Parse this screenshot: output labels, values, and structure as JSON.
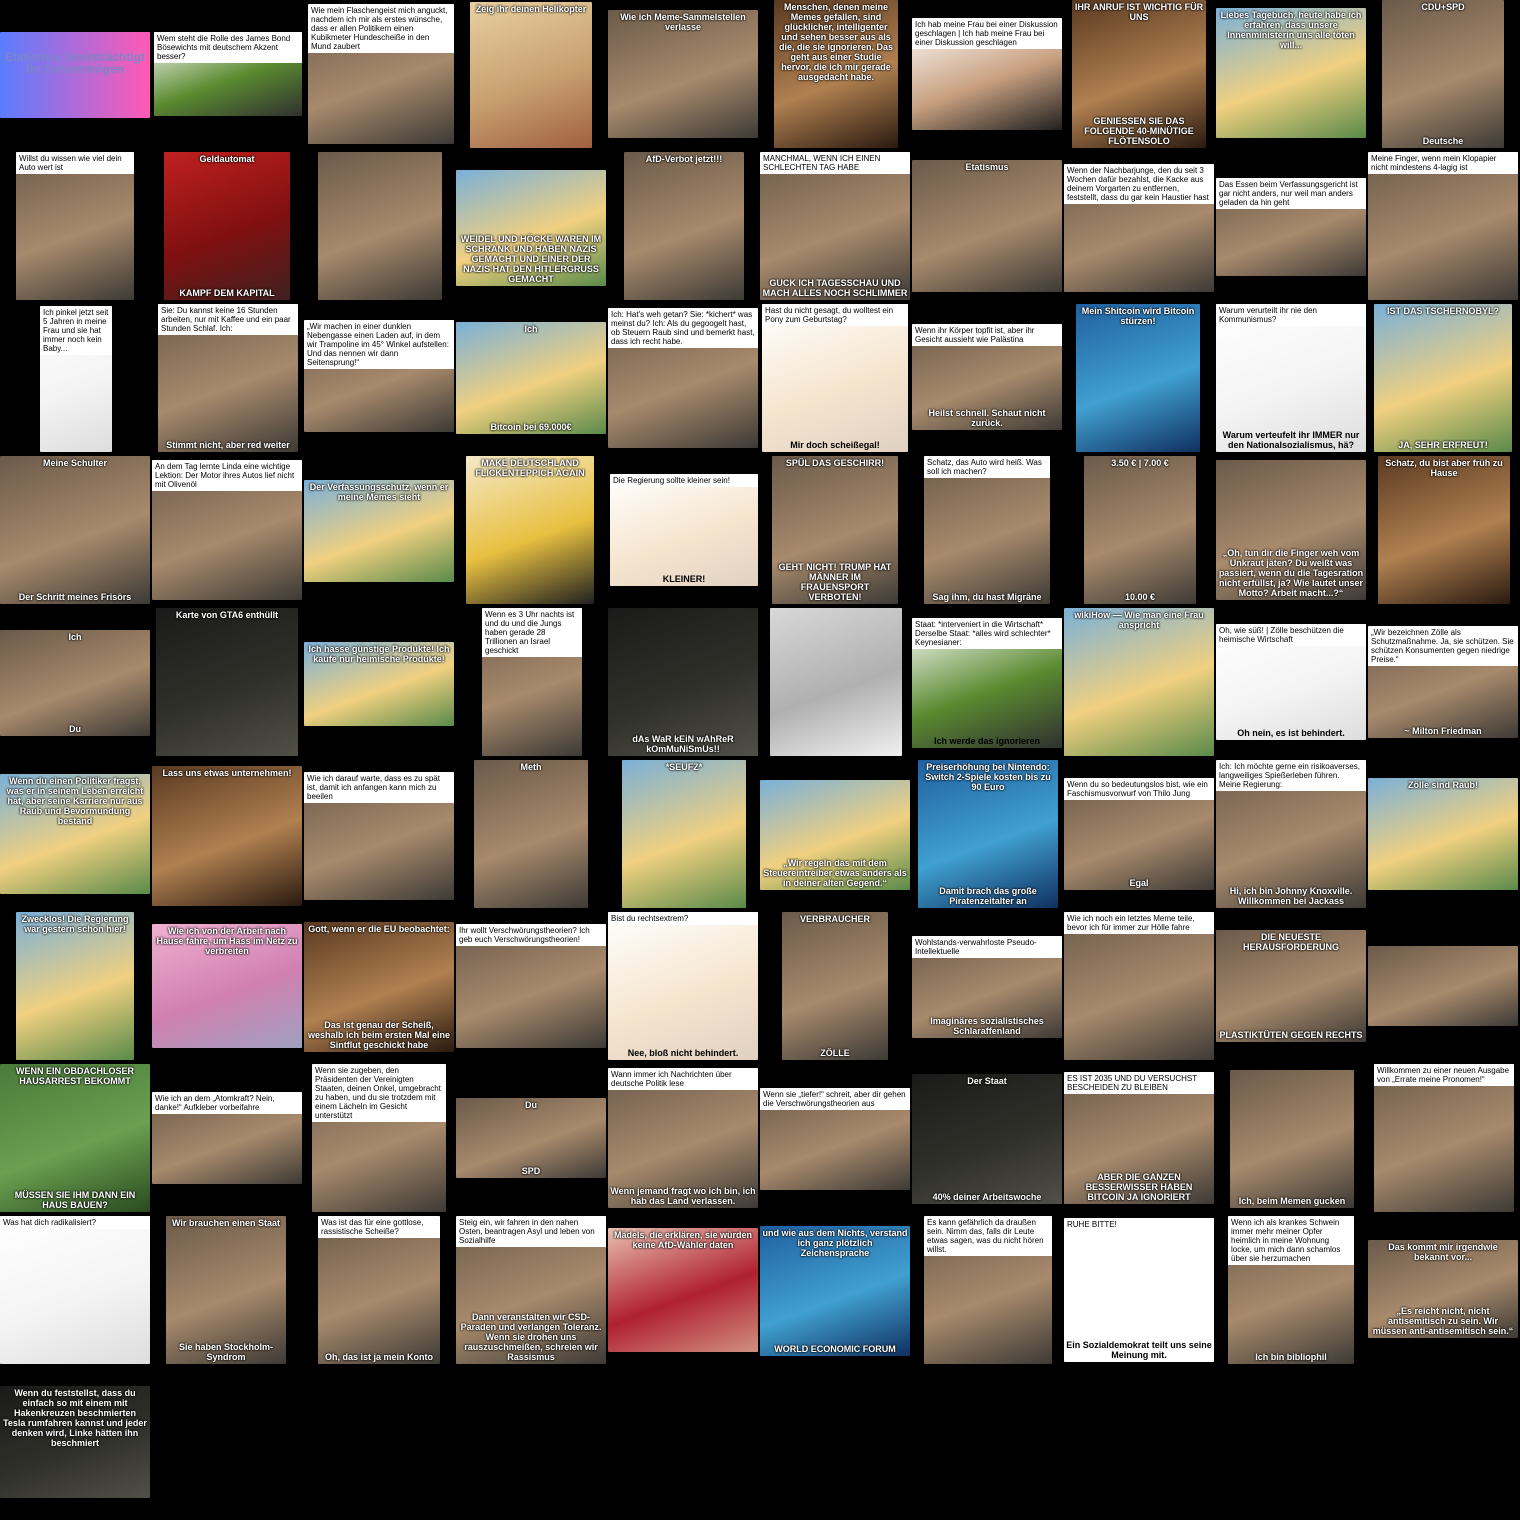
{
  "gallery": {
    "rows": [
      [
        {
          "top": "Etatismus beeinträchtigt Ihr Sehvermögen",
          "bottom": ""
        },
        {
          "top": "Wem steht die Rolle des James Bond Bösewichts mit deutschem Akzent besser?",
          "bottom": ""
        },
        {
          "top": "Wie mein Flaschengeist mich anguckt, nachdem ich mir als erstes wünsche, dass er allen Politikern einen Kubikmeter Hundescheiße in den Mund zaubert",
          "bottom": ""
        },
        {
          "top": "Zeig ihr deinen Helikopter",
          "bottom": ""
        },
        {
          "top": "Wie ich Meme-Sammelstellen verlasse",
          "bottom": ""
        },
        {
          "top": "Menschen, denen meine Memes gefallen, sind glücklicher, intelligenter und sehen besser aus als die, die sie ignorieren. Das geht aus einer Studie hervor, die ich mir gerade ausgedacht habe.",
          "bottom": ""
        },
        {
          "top": "Ich hab meine Frau bei einer Diskussion geschlagen | Ich hab meine Frau bei einer Diskussion geschlagen",
          "bottom": ""
        },
        {
          "top": "IHR ANRUF IST WICHTIG FÜR UNS",
          "bottom": "GENIESSEN SIE DAS FOLGENDE 40-MINÜTIGE FLÖTENSOLO"
        },
        {
          "top": "Liebes Tagebuch, heute habe ich erfahren, dass unsere Innenministerin uns alle töten will...",
          "bottom": ""
        },
        {
          "top": "CDU+SPD",
          "bottom": "Deutsche"
        }
      ],
      [
        {
          "top": "Willst du wissen wie viel dein Auto wert ist",
          "bottom": ""
        },
        {
          "top": "Geldautomat",
          "bottom": "KAMPF DEM KAPITAL"
        },
        {
          "top": "",
          "bottom": ""
        },
        {
          "top": "",
          "bottom": "WEIDEL UND HÖCKE WAREN IM SCHRANK UND HABEN NAZIS GEMACHT UND EINER DER NAZIS HAT DEN HITLERGRUSS GEMACHT"
        },
        {
          "top": "AfD-Verbot jetzt!!!",
          "bottom": ""
        },
        {
          "top": "MANCHMAL, WENN ICH EINEN SCHLECHTEN TAG HABE",
          "bottom": "GUCK ICH TAGESSCHAU UND MACH ALLES NOCH SCHLIMMER"
        },
        {
          "top": "Etatismus",
          "bottom": ""
        },
        {
          "top": "Wenn der Nachbarjunge, den du seit 3 Wochen dafür bezahlst, die Kacke aus deinem Vorgarten zu entfernen, feststellt, dass du gar kein Haustier hast",
          "bottom": ""
        },
        {
          "top": "Das Essen beim Verfassungsgericht ist gar nicht anders, nur weil man anders geladen da hin geht",
          "bottom": ""
        },
        {
          "top": "Meine Finger, wenn mein Klopapier nicht mindestens 4-lagig ist",
          "bottom": ""
        }
      ],
      [
        {
          "top": "Ich pinkel jetzt seit 5 Jahren in meine Frau und sie hat immer noch kein Baby...",
          "bottom": ""
        },
        {
          "top": "Sie: Du kannst keine 16 Stunden arbeiten, nur mit Kaffee und ein paar Stunden Schlaf. Ich:",
          "bottom": "Stimmt nicht, aber red weiter"
        },
        {
          "top": "„Wir machen in einer dunklen Nebengasse einen Laden auf, in dem wir Trampoline im 45° Winkel aufstellen: Und das nennen wir dann Seitensprung!“",
          "bottom": ""
        },
        {
          "top": "Ich",
          "bottom": "Bitcoin bei 69.000€"
        },
        {
          "top": "Ich: Hat's weh getan? Sie: *kichert* was meinst du? Ich: Als du gegoogelt hast, ob Steuern Raub sind und bemerkt hast, dass ich recht habe.",
          "bottom": ""
        },
        {
          "top": "Hast du nicht gesagt, du wolltest ein Pony zum Geburtstag?",
          "bottom": "Mir doch scheißegal!"
        },
        {
          "top": "Wenn ihr Körper topfit ist, aber ihr Gesicht aussieht wie Palästina",
          "bottom": "Heilst schnell. Schaut nicht zurück."
        },
        {
          "top": "Mein Shitcoin wird Bitcoin stürzen!",
          "bottom": ""
        },
        {
          "top": "Warum verurteilt ihr nie den Kommunismus?",
          "bottom": "Warum verteufelt ihr IMMER nur den Nationalsozialismus, hä?"
        },
        {
          "top": "IST DAS TSCHERNOBYL?",
          "bottom": "JA, SEHR ERFREUT!"
        }
      ],
      [
        {
          "top": "Meine Schulter",
          "bottom": "Der Schritt meines Frisörs"
        },
        {
          "top": "An dem Tag lernte Linda eine wichtige Lektion: Der Motor ihres Autos lief nicht mit Olivenöl",
          "bottom": ""
        },
        {
          "top": "Der Verfassungsschutz, wenn er meine Memes sieht",
          "bottom": ""
        },
        {
          "top": "MAKE DEUTSCHLAND FLICKENTEPPICH AGAIN",
          "bottom": ""
        },
        {
          "top": "Die Regierung sollte kleiner sein!",
          "bottom": "KLEINER!"
        },
        {
          "top": "SPÜL DAS GESCHIRR!",
          "bottom": "GEHT NICHT! TRUMP HAT MÄNNER IM FRAUENSPORT VERBOTEN!"
        },
        {
          "top": "Schatz, das Auto wird heiß. Was soll ich machen?",
          "bottom": "Sag ihm, du hast Migräne"
        },
        {
          "top": "3.50 € | 7.00 €",
          "bottom": "10.00 €"
        },
        {
          "top": "",
          "bottom": "„Oh, tun dir die Finger weh vom Unkraut jäten? Du weißt was passiert, wenn du die Tagesration nicht erfüllst, ja? Wie lautet unser Motto? Arbeit macht...?“"
        },
        {
          "top": "Schatz, du bist aber früh zu Hause",
          "bottom": ""
        }
      ],
      [
        {
          "top": "Ich",
          "bottom": "Du"
        },
        {
          "top": "Karte von GTA6 enthüllt",
          "bottom": ""
        },
        {
          "top": "Ich hasse günstige Produkte! Ich kaufe nur heimische Produkte!",
          "bottom": ""
        },
        {
          "top": "Wenn es 3 Uhr nachts ist und du und die Jungs haben gerade 28 Trillionen an Israel geschickt",
          "bottom": ""
        },
        {
          "top": "",
          "bottom": "dAs WaR kEiN wAhReR kOmMuNiSmUs!!"
        },
        {
          "top": "",
          "bottom": ""
        },
        {
          "top": "Staat: *interveniert in die Wirtschaft* Derselbe Staat: *alles wird schlechter* Keynesianer:",
          "bottom": "Ich werde das ignorieren"
        },
        {
          "top": "wikiHow — Wie man eine Frau anspricht",
          "bottom": ""
        },
        {
          "top": "Oh, wie süß! | Zölle beschützen die heimische Wirtschaft",
          "bottom": "Oh nein, es ist behindert."
        },
        {
          "top": "„Wir bezeichnen Zölle als Schutzmaßnahme. Ja, sie schützen. Sie schützen Konsumenten gegen niedrige Preise.“",
          "bottom": "~ Milton Friedman"
        }
      ],
      [
        {
          "top": "Wenn du einen Politiker fragst, was er in seinem Leben erreicht hat, aber seine Karriere nur aus Raub und Bevormundung bestand",
          "bottom": ""
        },
        {
          "top": "Lass uns etwas unternehmen!",
          "bottom": ""
        },
        {
          "top": "Wie ich darauf warte, dass es zu spät ist, damit ich anfangen kann mich zu beeilen",
          "bottom": ""
        },
        {
          "top": "Meth",
          "bottom": ""
        },
        {
          "top": "*SEUFZ*",
          "bottom": ""
        },
        {
          "top": "",
          "bottom": "„Wir regeln das mit dem Steuereintreiber etwas anders als in deiner alten Gegend.“"
        },
        {
          "top": "Preiserhöhung bei Nintendo: Switch 2-Spiele kosten bis zu 90 Euro",
          "bottom": "Damit brach das große Piratenzeitalter an"
        },
        {
          "top": "Wenn du so bedeutungslos bist, wie ein Faschismusvorwurf von Thilo Jung",
          "bottom": "Egal"
        },
        {
          "top": "Ich: Ich möchte gerne ein risikoaverses, langweiliges Spießerleben führen. Meine Regierung:",
          "bottom": "Hi, ich bin Johnny Knoxville. Willkommen bei Jackass"
        },
        {
          "top": "Zölle sind Raub!",
          "bottom": ""
        }
      ],
      [
        {
          "top": "Zwecklos! Die Regierung war gestern schon hier!",
          "bottom": ""
        },
        {
          "top": "Wie ich von der Arbeit nach Hause fahre, um Hass im Netz zu verbreiten",
          "bottom": ""
        },
        {
          "top": "Gott, wenn er die EU beobachtet:",
          "bottom": "Das ist genau der Scheiß, weshalb ich beim ersten Mal eine Sintflut geschickt habe"
        },
        {
          "top": "Ihr wollt Verschwörungstheorien? Ich geb euch Verschwörungstheorien!",
          "bottom": ""
        },
        {
          "top": "Bist du rechtsextrem?",
          "bottom": "Nee, bloß nicht behindert."
        },
        {
          "top": "VERBRAUCHER",
          "bottom": "ZÖLLE"
        },
        {
          "top": "Wohlstands-verwahrloste Pseudo-Intellektuelle",
          "bottom": "Imaginäres sozialistisches Schlaraffenland"
        },
        {
          "top": "Wie ich noch ein letztes Meme teile, bevor ich für immer zur Hölle fahre",
          "bottom": ""
        },
        {
          "top": "DIE NEUESTE HERAUSFORDERUNG",
          "bottom": "PLASTIKTÜTEN GEGEN RECHTS"
        },
        {
          "top": "",
          "bottom": ""
        }
      ],
      [
        {
          "top": "WENN EIN OBDACHLOSER HAUSARREST BEKOMMT",
          "bottom": "MÜSSEN SIE IHM DANN EIN HAUS BAUEN?"
        },
        {
          "top": "Wie ich an dem „Atomkraft? Nein, danke!“ Aufkleber vorbeifahre",
          "bottom": ""
        },
        {
          "top": "Wenn sie zugeben, den Präsidenten der Vereinigten Staaten, deinen Onkel, umgebracht zu haben, und du sie trotzdem mit einem Lächeln im Gesicht unterstützt",
          "bottom": ""
        },
        {
          "top": "Du",
          "bottom": "SPD"
        },
        {
          "top": "Wann immer ich Nachrichten über deutsche Politik lese",
          "bottom": "Wenn jemand fragt wo ich bin, ich hab das Land verlassen."
        },
        {
          "top": "Wenn sie „tiefer!“ schreit, aber dir gehen die Verschwörungstheorien aus",
          "bottom": ""
        },
        {
          "top": "Der Staat",
          "bottom": "40% deiner Arbeitswoche"
        },
        {
          "top": "ES IST 2035 UND DU VERSUCHST BESCHEIDEN ZU BLEIBEN",
          "bottom": "ABER DIE GANZEN BESSERWISSER HABEN BITCOIN JA IGNORIERT"
        },
        {
          "top": "",
          "bottom": "Ich, beim Memen gucken"
        },
        {
          "top": "Willkommen zu einer neuen Ausgabe von „Errate meine Pronomen!“",
          "bottom": ""
        }
      ],
      [
        {
          "top": "Was hat dich radikalisiert?",
          "bottom": ""
        },
        {
          "top": "Wir brauchen einen Staat",
          "bottom": "Sie haben Stockholm-Syndrom"
        },
        {
          "top": "Was ist das für eine gottlose, rassistische Scheiße?",
          "bottom": "Oh, das ist ja mein Konto"
        },
        {
          "top": "Steig ein, wir fahren in den nahen Osten, beantragen Asyl und leben von Sozialhilfe",
          "bottom": "Dann veranstalten wir CSD-Paraden und verlangen Toleranz. Wenn sie drohen uns rauszuschmeißen, schreien wir Rassismus"
        },
        {
          "top": "Mädels, die erklären, sie würden keine AfD-Wähler daten",
          "bottom": ""
        },
        {
          "top": "und wie aus dem Nichts, verstand ich ganz plötzlich Zeichensprache",
          "bottom": "WORLD ECONOMIC FORUM"
        },
        {
          "top": "Es kann gefährlich da draußen sein. Nimm das, falls dir Leute etwas sagen, was du nicht hören willst.",
          "bottom": ""
        },
        {
          "top": "RUHE BITTE!",
          "bottom": "Ein Sozialdemokrat teilt uns seine Meinung mit."
        },
        {
          "top": "Wenn ich als krankes Schwein immer mehr meiner Opfer heimlich in meine Wohnung locke, um mich dann schamlos über sie herzumachen",
          "bottom": "Ich bin bibliophil"
        },
        {
          "top": "Das kommt mir irgendwie bekannt vor...",
          "bottom": "„Es reicht nicht, nicht antisemitisch zu sein. Wir müssen anti-antisemitisch sein.“"
        }
      ],
      [
        {
          "top": "Wenn du feststellst, dass du einfach so mit einem mit Hakenkreuzen beschmierten Tesla rumfahren kannst und jeder denken wird, Linke hätten ihn beschmiert",
          "bottom": ""
        }
      ]
    ]
  },
  "theme": {
    "background": "#000000",
    "caption_bg": "#ffffff",
    "accent_gradient": [
      "#5a7dff",
      "#ff5ab4"
    ]
  }
}
